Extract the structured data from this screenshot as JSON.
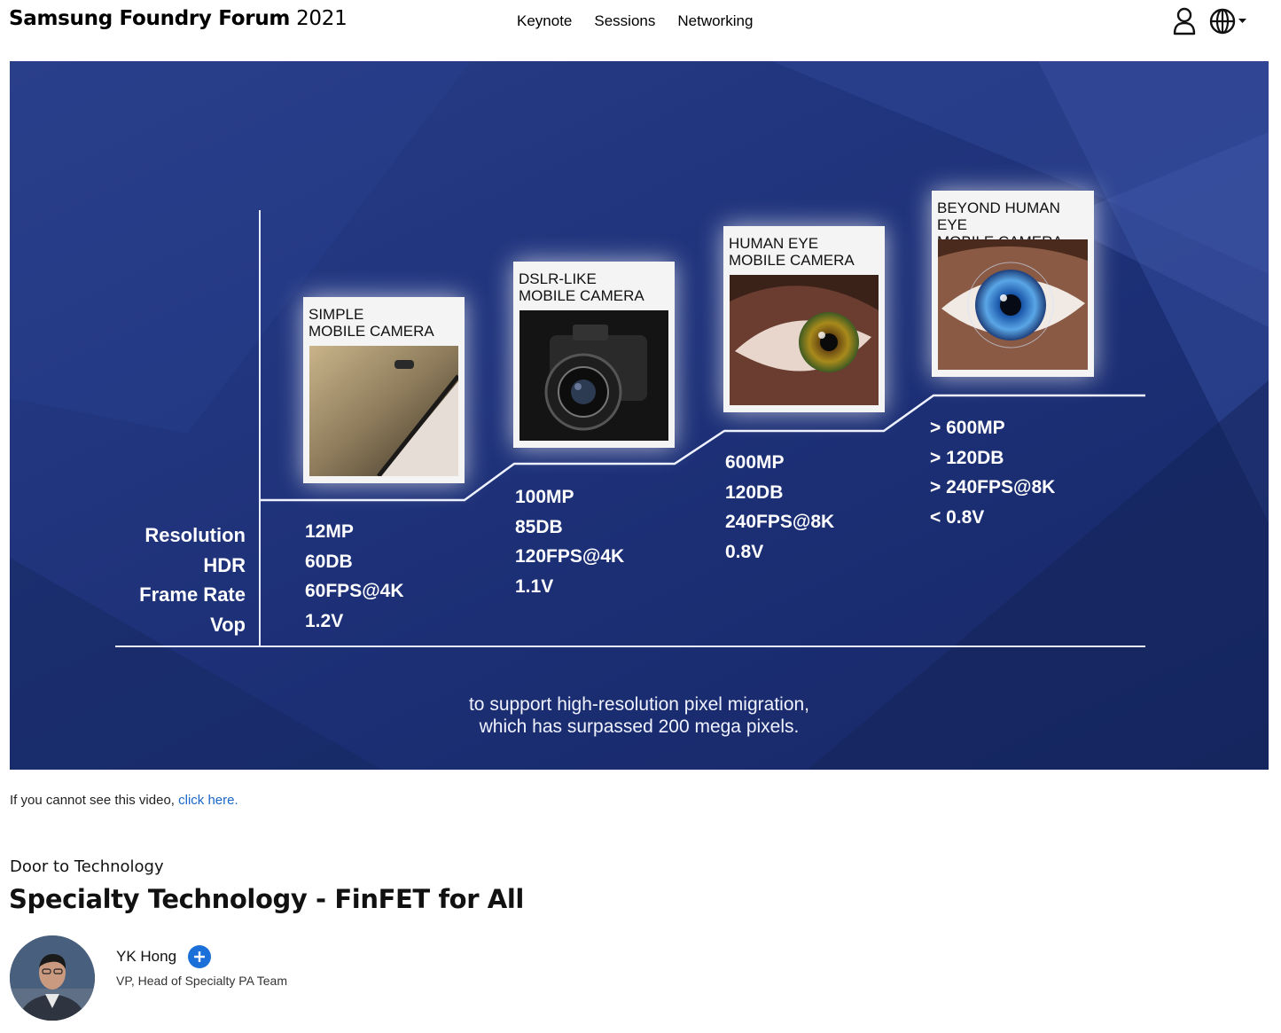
{
  "header": {
    "brand_bold": "Samsung Foundry Forum",
    "brand_year": "2021",
    "nav": [
      "Keynote",
      "Sessions",
      "Networking"
    ],
    "icons": [
      "user-icon",
      "globe-icon",
      "caret-down-icon"
    ]
  },
  "slide": {
    "row_labels": [
      "Resolution",
      "HDR",
      "Frame Rate",
      "Vop"
    ],
    "stages": [
      {
        "title": "SIMPLE\nMOBILE CAMERA",
        "values": [
          "12MP",
          "60DB",
          "60FPS@4K",
          "1.2V"
        ]
      },
      {
        "title": "DSLR-LIKE\nMOBILE CAMERA",
        "values": [
          "100MP",
          "85DB",
          "120FPS@4K",
          "1.1V"
        ]
      },
      {
        "title": "HUMAN EYE\nMOBILE CAMERA",
        "values": [
          "600MP",
          "120DB",
          "240FPS@8K",
          "0.8V"
        ]
      },
      {
        "title": "BEYOND HUMAN EYE\nMOBILE CAMERA",
        "values": [
          "> 600MP",
          "> 120DB",
          "> 240FPS@8K",
          "< 0.8V"
        ]
      }
    ],
    "caption_line1": "to support high-resolution pixel migration,",
    "caption_line2": "which has surpassed 200 mega pixels."
  },
  "fallback": {
    "text": "If you cannot see this video, ",
    "link": "click here."
  },
  "session": {
    "kicker": "Door to Technology",
    "title": "Specialty Technology - FinFET for All"
  },
  "speaker": {
    "name": "YK Hong",
    "role": "VP, Head of Specialty PA Team"
  },
  "colors": {
    "slide_bg": "#1f3278",
    "link": "#1a66c9",
    "add_button": "#1a6fd9"
  }
}
